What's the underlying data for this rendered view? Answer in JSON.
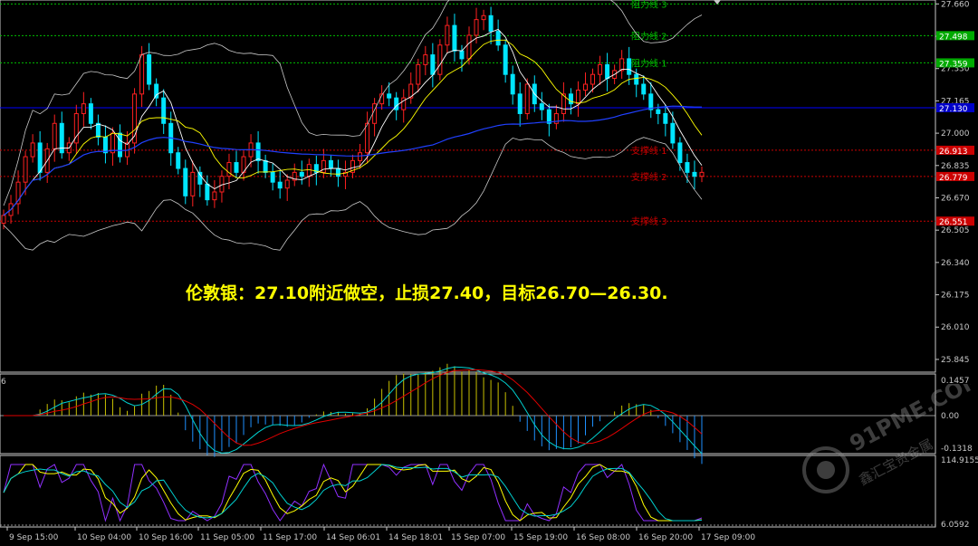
{
  "annotation": "伦敦银：27.10附近做空，止损27.40，目标26.70—26.30.",
  "watermark": {
    "text": "91PME.COM",
    "subtext": "鑫汇宝贵金属"
  },
  "chart_data": {
    "type": "candlestick",
    "instrument": "London Silver",
    "y_ticks": [
      "27.660",
      "27.495",
      "27.330",
      "27.165",
      "27.000",
      "26.835",
      "26.670",
      "26.505",
      "26.340",
      "26.175",
      "26.010",
      "25.845"
    ],
    "ylim": [
      25.78,
      27.68
    ],
    "price_labels": [
      {
        "value": 27.498,
        "text": "27.498",
        "bg": "#00aa00"
      },
      {
        "value": 27.359,
        "text": "27.359",
        "bg": "#00aa00"
      },
      {
        "value": 27.13,
        "text": "27.130",
        "bg": "#0000c8"
      },
      {
        "value": 26.913,
        "text": "26.913",
        "bg": "#cc0000"
      },
      {
        "value": 26.779,
        "text": "26.779",
        "bg": "#cc0000"
      },
      {
        "value": 26.551,
        "text": "26.551",
        "bg": "#cc0000"
      }
    ],
    "levels": [
      {
        "name": "阻力线 3",
        "value": 27.66,
        "color": "#00c000"
      },
      {
        "name": "阻力线 2",
        "value": 27.498,
        "color": "#00c000"
      },
      {
        "name": "阻力线 1",
        "value": 27.359,
        "color": "#00c000"
      },
      {
        "name": "支撑线 1",
        "value": 26.913,
        "color": "#cc0000"
      },
      {
        "name": "支撑线 2",
        "value": 26.779,
        "color": "#cc0000"
      },
      {
        "name": "支撑线 3",
        "value": 26.551,
        "color": "#cc0000"
      }
    ],
    "blue_line": 27.13,
    "x_labels": [
      "9 Sep 15:00",
      "10 Sep 04:00",
      "10 Sep 16:00",
      "11 Sep 05:00",
      "11 Sep 17:00",
      "14 Sep 06:01",
      "14 Sep 18:01",
      "15 Sep 07:00",
      "15 Sep 19:00",
      "16 Sep 08:00",
      "16 Sep 20:00",
      "17 Sep 09:00"
    ],
    "close_series": [
      26.58,
      26.64,
      26.75,
      26.88,
      26.95,
      26.8,
      26.92,
      27.05,
      26.9,
      26.95,
      27.1,
      27.15,
      27.05,
      26.98,
      26.9,
      27.0,
      26.88,
      26.95,
      27.2,
      27.4,
      27.25,
      27.18,
      27.05,
      26.9,
      26.82,
      26.68,
      26.8,
      26.74,
      26.66,
      26.7,
      26.78,
      26.85,
      26.8,
      26.88,
      26.95,
      26.86,
      26.8,
      26.75,
      26.72,
      26.76,
      26.8,
      26.78,
      26.84,
      26.8,
      26.86,
      26.82,
      26.78,
      26.8,
      26.86,
      26.9,
      27.05,
      27.15,
      27.2,
      27.18,
      27.12,
      27.18,
      27.25,
      27.35,
      27.4,
      27.3,
      27.45,
      27.55,
      27.42,
      27.38,
      27.5,
      27.58,
      27.6,
      27.52,
      27.45,
      27.3,
      27.2,
      27.1,
      27.25,
      27.15,
      27.12,
      27.05,
      27.1,
      27.2,
      27.15,
      27.22,
      27.25,
      27.3,
      27.35,
      27.28,
      27.32,
      27.38,
      27.3,
      27.25,
      27.2,
      27.12,
      27.1,
      27.05,
      26.95,
      26.85,
      26.8,
      26.78,
      26.8
    ],
    "macd_pane": {
      "y_labels": [
        "0.1457",
        "0.00",
        "-0.1318"
      ],
      "corner": "6"
    },
    "stoch_pane": {
      "y_labels": [
        "114.9155",
        "6.0592"
      ]
    }
  }
}
